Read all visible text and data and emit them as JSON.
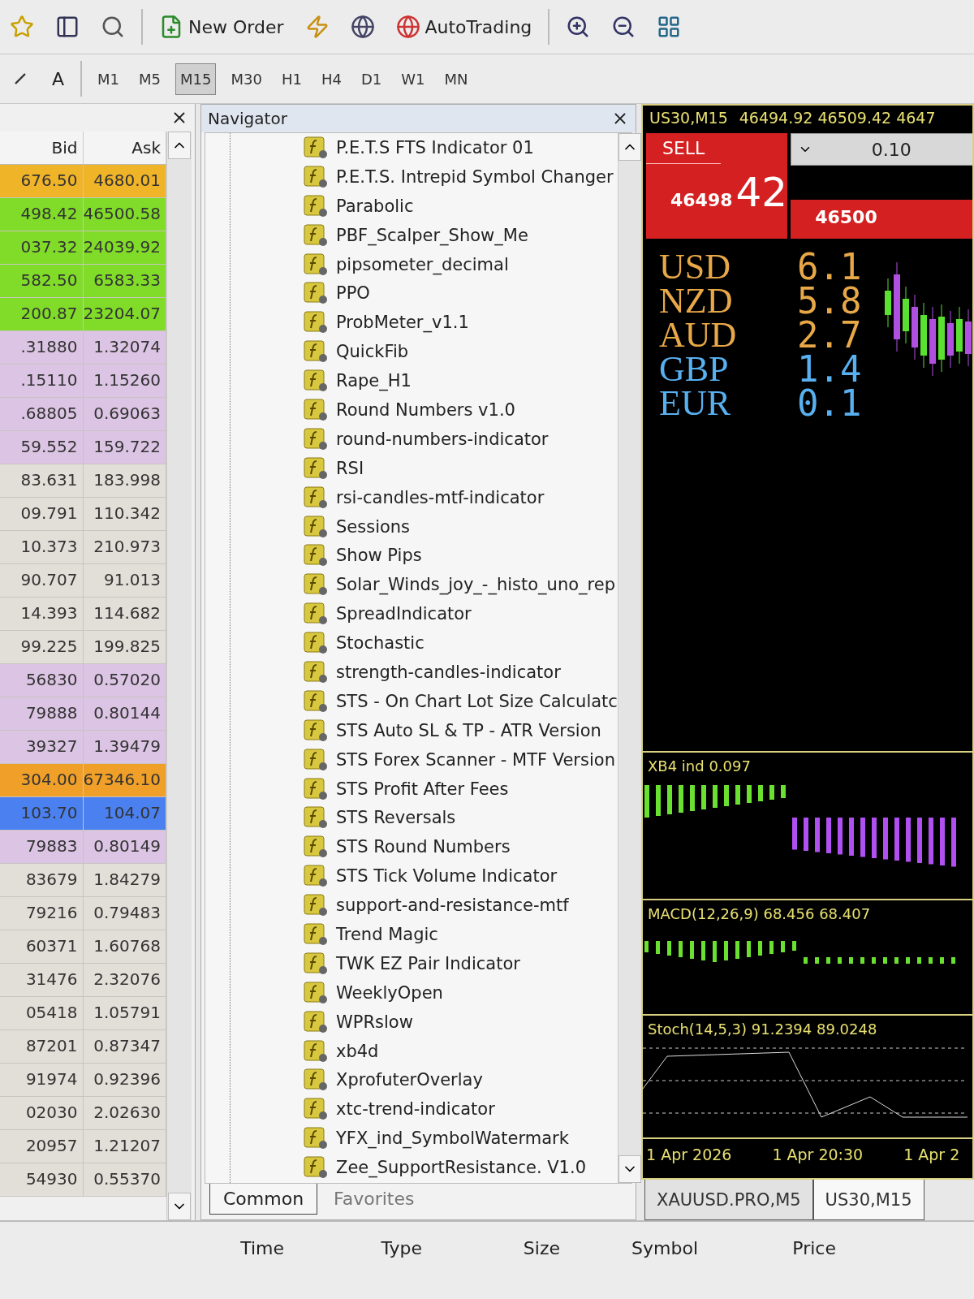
{
  "toolbar": {
    "new_order": "New Order",
    "autotrading": "AutoTrading",
    "text_tool": "A"
  },
  "timeframes": [
    {
      "label": "M1",
      "selected": false
    },
    {
      "label": "M5",
      "selected": false
    },
    {
      "label": "M15",
      "selected": true
    },
    {
      "label": "M30",
      "selected": false
    },
    {
      "label": "H1",
      "selected": false
    },
    {
      "label": "H4",
      "selected": false
    },
    {
      "label": "D1",
      "selected": false
    },
    {
      "label": "W1",
      "selected": false
    },
    {
      "label": "MN",
      "selected": false
    }
  ],
  "market_watch": {
    "columns": [
      "Bid",
      "Ask"
    ],
    "rows": [
      {
        "bid": "676.50",
        "ask": "4680.01",
        "color": "#f0b428"
      },
      {
        "bid": "498.42",
        "ask": "46500.58",
        "color": "#80dc28"
      },
      {
        "bid": "037.32",
        "ask": "24039.92",
        "color": "#80dc28"
      },
      {
        "bid": "582.50",
        "ask": "6583.33",
        "color": "#80dc28"
      },
      {
        "bid": "200.87",
        "ask": "23204.07",
        "color": "#80dc28"
      },
      {
        "bid": ".31880",
        "ask": "1.32074",
        "color": "#dcc4e4"
      },
      {
        "bid": ".15110",
        "ask": "1.15260",
        "color": "#dcc4e4"
      },
      {
        "bid": ".68805",
        "ask": "0.69063",
        "color": "#dcc4e4"
      },
      {
        "bid": "59.552",
        "ask": "159.722",
        "color": "#dcc4e4"
      },
      {
        "bid": "83.631",
        "ask": "183.998",
        "color": "#e2ded8"
      },
      {
        "bid": "09.791",
        "ask": "110.342",
        "color": "#e2ded8"
      },
      {
        "bid": "10.373",
        "ask": "210.973",
        "color": "#e2ded8"
      },
      {
        "bid": "90.707",
        "ask": "91.013",
        "color": "#e2ded8"
      },
      {
        "bid": "14.393",
        "ask": "114.682",
        "color": "#e2ded8"
      },
      {
        "bid": "99.225",
        "ask": "199.825",
        "color": "#e2ded8"
      },
      {
        "bid": "56830",
        "ask": "0.57020",
        "color": "#dcc4e4"
      },
      {
        "bid": "79888",
        "ask": "0.80144",
        "color": "#dcc4e4"
      },
      {
        "bid": "39327",
        "ask": "1.39479",
        "color": "#dcc4e4"
      },
      {
        "bid": "304.00",
        "ask": "67346.10",
        "color": "#f0a028"
      },
      {
        "bid": "103.70",
        "ask": "104.07",
        "color": "#4a80f0"
      },
      {
        "bid": "79883",
        "ask": "0.80149",
        "color": "#dcc4e4"
      },
      {
        "bid": "83679",
        "ask": "1.84279",
        "color": "#e2ded8"
      },
      {
        "bid": "79216",
        "ask": "0.79483",
        "color": "#e2ded8"
      },
      {
        "bid": "60371",
        "ask": "1.60768",
        "color": "#e2ded8"
      },
      {
        "bid": "31476",
        "ask": "2.32076",
        "color": "#e2ded8"
      },
      {
        "bid": "05418",
        "ask": "1.05791",
        "color": "#e2ded8"
      },
      {
        "bid": "87201",
        "ask": "0.87347",
        "color": "#e2ded8"
      },
      {
        "bid": "91974",
        "ask": "0.92396",
        "color": "#e2ded8"
      },
      {
        "bid": "02030",
        "ask": "2.02630",
        "color": "#e2ded8"
      },
      {
        "bid": "20957",
        "ask": "1.21207",
        "color": "#e2ded8"
      },
      {
        "bid": "54930",
        "ask": "0.55370",
        "color": "#e2ded8"
      }
    ]
  },
  "navigator": {
    "title": "Navigator",
    "items": [
      "P.E.T.S FTS Indicator 01",
      "P.E.T.S. Intrepid Symbol Changer",
      "Parabolic",
      "PBF_Scalper_Show_Me",
      "pipsometer_decimal",
      "PPO",
      "ProbMeter_v1.1",
      "QuickFib",
      "Rape_H1",
      "Round Numbers v1.0",
      "round-numbers-indicator",
      "RSI",
      "rsi-candles-mtf-indicator",
      "Sessions",
      "Show Pips",
      "Solar_Winds_joy_-_histo_uno_rep",
      "SpreadIndicator",
      "Stochastic",
      "strength-candles-indicator",
      "STS - On Chart Lot Size Calculatc",
      "STS Auto SL & TP - ATR Version",
      "STS Forex Scanner - MTF Version",
      "STS Profit After Fees",
      "STS Reversals",
      "STS Round Numbers",
      "STS Tick Volume Indicator",
      "support-and-resistance-mtf",
      "Trend Magic",
      "TWK EZ Pair Indicator",
      "WeeklyOpen",
      "WPRslow",
      "xb4d",
      "XprofuterOverlay",
      "xtc-trend-indicator",
      "YFX_ind_SymbolWatermark",
      "Zee_SupportResistance. V1.0"
    ],
    "tabs": [
      {
        "label": "Common",
        "selected": true
      },
      {
        "label": "Favorites",
        "selected": false
      }
    ]
  },
  "chart": {
    "symbol": "US30,M15",
    "prices": "46494.92 46509.42 4647",
    "trade_panel": {
      "sell_label": "SELL",
      "lot": "0.10",
      "sell_price": "46498",
      "sell_pips": "42",
      "buy_price": "46500"
    },
    "strength": [
      {
        "currency": "USD",
        "value": "6.1",
        "color": "#e8a848"
      },
      {
        "currency": "NZD",
        "value": "5.8",
        "color": "#e8a848"
      },
      {
        "currency": "AUD",
        "value": "2.7",
        "color": "#e8a848"
      },
      {
        "currency": "GBP",
        "value": "1.4",
        "color": "#58b0f0"
      },
      {
        "currency": "EUR",
        "value": "0.1",
        "color": "#58b0f0"
      }
    ],
    "subwindows": [
      {
        "kind": "histogram",
        "label": "XB4 ind 0.097"
      },
      {
        "kind": "macd",
        "label": "MACD(12,26,9) 68.456 68.407"
      },
      {
        "kind": "stochastic",
        "label": "Stoch(14,5,3) 91.2394 89.0248"
      }
    ],
    "time_axis": [
      "1 Apr 2026",
      "1 Apr 20:30",
      "1 Apr 2"
    ],
    "tabs": [
      {
        "label": "XAUUSD.PRO,M5",
        "selected": false
      },
      {
        "label": "US30,M15",
        "selected": true
      }
    ]
  },
  "terminal": {
    "columns": [
      "Time",
      "Type",
      "Size",
      "Symbol",
      "Price"
    ]
  }
}
